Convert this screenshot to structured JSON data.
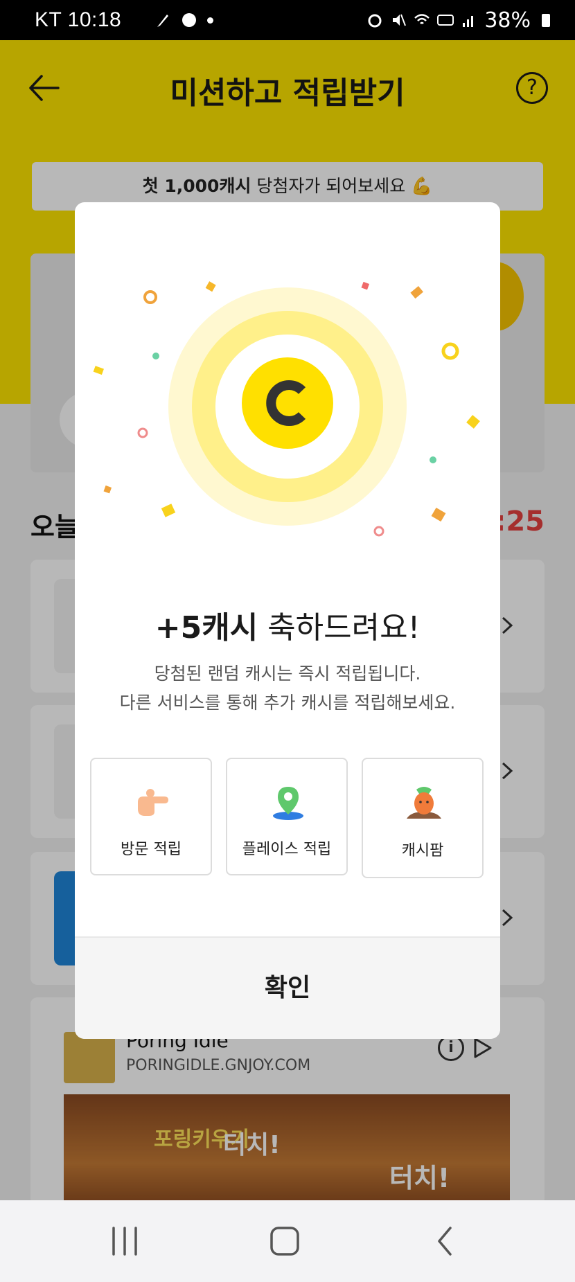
{
  "status_bar": {
    "carrier_time": "KT 10:18",
    "battery": "38%"
  },
  "header": {
    "title": "미션하고 적립받기",
    "help_label": "?",
    "promo": {
      "strong": "첫 1,000캐시",
      "rest": " 당첨자가 되어보세요 💪"
    }
  },
  "section": {
    "title": "오늘",
    "timer": ":25"
  },
  "ad": {
    "title": "Poring Idle",
    "domain": "PORINGIDLE.GNJOY.COM",
    "info_label": "i",
    "image_text_1": "포링키우기",
    "image_text_2": "터치!",
    "image_text_3": "터치!"
  },
  "modal": {
    "coin_letter": "C",
    "headline_strong": "+5캐시",
    "headline_rest": " 축하드려요!",
    "desc_line1": "당첨된 랜덤 캐시는 즉시 적립됩니다.",
    "desc_line2": "다른 서비스를 통해 추가 캐시를 적립해보세요.",
    "services": [
      {
        "label": "방문 적립",
        "icon": "pointing-hand-icon"
      },
      {
        "label": "플레이스 적립",
        "icon": "location-pin-icon"
      },
      {
        "label": "캐시팜",
        "icon": "carrot-character-icon"
      }
    ],
    "confirm_label": "확인"
  },
  "colors": {
    "brand_yellow": "#fee500",
    "coin_yellow": "#ffe000",
    "timer_red": "#e5403f"
  }
}
